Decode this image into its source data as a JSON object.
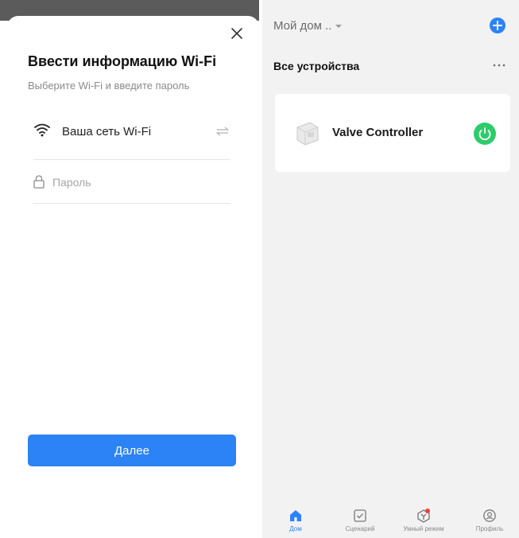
{
  "wifi_sheet": {
    "title": "Ввести информацию Wi-Fi",
    "subtitle": "Выберите Wi-Fi и введите пароль",
    "network_name": "Ваша сеть Wi-Fi",
    "password": {
      "value": "",
      "placeholder": "Пароль"
    },
    "next_label": "Далее",
    "accent": "#2c83f5"
  },
  "home": {
    "home_name": "Мой дом ..",
    "section_title": "Все устройства",
    "devices": [
      {
        "name": "Valve Controller",
        "icon": "valve-device-image",
        "power_color": "#2ecb6b"
      }
    ]
  },
  "tabs": [
    {
      "label": "Дом",
      "icon": "home-icon",
      "active": true
    },
    {
      "label": "Сценарий",
      "icon": "scene-icon",
      "active": false
    },
    {
      "label": "Умный режим",
      "icon": "smart-icon",
      "active": false,
      "badge_color": "#e8423b"
    },
    {
      "label": "Профиль",
      "icon": "profile-icon",
      "active": false
    }
  ]
}
